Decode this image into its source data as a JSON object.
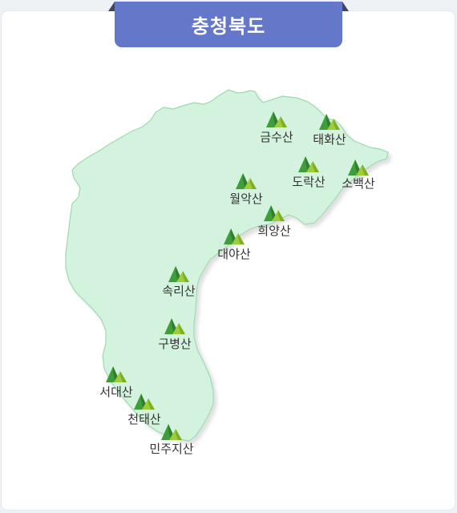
{
  "title": "충청북도",
  "colors": {
    "region_fill": "#d3f3df",
    "region_stroke": "#9ed8b0",
    "title_bg": "#6477c8"
  },
  "mountains": [
    {
      "name": "금수산"
    },
    {
      "name": "태화산"
    },
    {
      "name": "도락산"
    },
    {
      "name": "소백산"
    },
    {
      "name": "월악산"
    },
    {
      "name": "희양산"
    },
    {
      "name": "대야산"
    },
    {
      "name": "속리산"
    },
    {
      "name": "구병산"
    },
    {
      "name": "서대산"
    },
    {
      "name": "천태산"
    },
    {
      "name": "민주지산"
    }
  ]
}
